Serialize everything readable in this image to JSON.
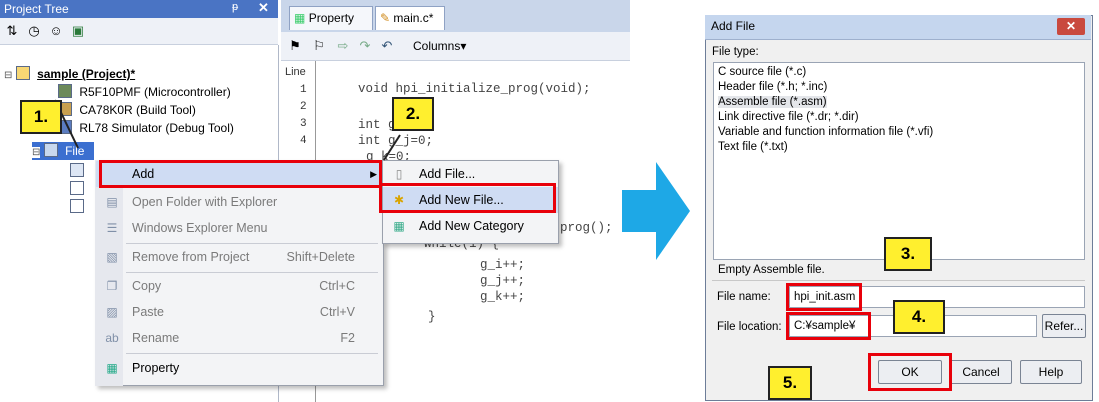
{
  "project_tree": {
    "title": "Project Tree",
    "pin": "ᵽ",
    "close": "✕",
    "items": [
      {
        "label": "sample (Project)*"
      },
      {
        "label": "R5F10PMF (Microcontroller)"
      },
      {
        "label": "CA78K0R (Build Tool)"
      },
      {
        "label": "RL78 Simulator (Debug Tool)"
      },
      {
        "label": "File"
      }
    ]
  },
  "editor": {
    "tabs": [
      {
        "label": "Property"
      },
      {
        "label": "main.c*"
      }
    ],
    "toolbar_columns": "Columns",
    "gutter_header": "Line",
    "line_numbers": [
      "1",
      "2",
      "3",
      "4"
    ],
    "code": [
      "void hpi_initialize_prog(void);",
      "int g_i=0;",
      "int g_j=0;",
      "g_k=0;",
      "prog();",
      "while(1) {",
      "g_i++;",
      "g_j++;",
      "g_k++;",
      "}"
    ]
  },
  "context_menu": {
    "items": [
      {
        "label": "Add",
        "shortcut": "",
        "icon": "blank"
      },
      {
        "label": "Open Folder with Explorer",
        "shortcut": "",
        "icon": "folder-icon"
      },
      {
        "label": "Windows Explorer Menu",
        "shortcut": "",
        "icon": "menu-icon"
      },
      {
        "label": "Remove from Project",
        "shortcut": "Shift+Delete",
        "icon": "remove-icon"
      },
      {
        "label": "Copy",
        "shortcut": "Ctrl+C",
        "icon": "copy-icon"
      },
      {
        "label": "Paste",
        "shortcut": "Ctrl+V",
        "icon": "paste-icon"
      },
      {
        "label": "Rename",
        "shortcut": "F2",
        "icon": "rename-icon"
      },
      {
        "label": "Property",
        "shortcut": "",
        "icon": "property-icon"
      }
    ],
    "submenu": [
      {
        "label": "Add File..."
      },
      {
        "label": "Add New File..."
      },
      {
        "label": "Add New Category"
      }
    ]
  },
  "callouts": {
    "c1": "1.",
    "c2": "2.",
    "c3": "3.",
    "c4": "4.",
    "c5": "5."
  },
  "dialog": {
    "title": "Add File",
    "close": "✕",
    "file_type_label": "File type:",
    "file_types": [
      "C source file (*.c)",
      "Header file (*.h; *.inc)",
      "Assemble file (*.asm)",
      "Link directive file (*.dr; *.dir)",
      "Variable and function information file (*.vfi)",
      "Text file (*.txt)"
    ],
    "description": "Empty Assemble file.",
    "file_name_label": "File name:",
    "file_name_value": "hpi_init.asm",
    "file_location_label": "File location:",
    "file_location_value": "C:¥sample¥",
    "refer_button": "Refer...",
    "ok_button": "OK",
    "cancel_button": "Cancel",
    "help_button": "Help"
  },
  "colors": {
    "highlight": "#e8000a",
    "callout": "#ffef2e",
    "arrow": "#1ea8e6",
    "title_bar": "#4a74c4"
  }
}
